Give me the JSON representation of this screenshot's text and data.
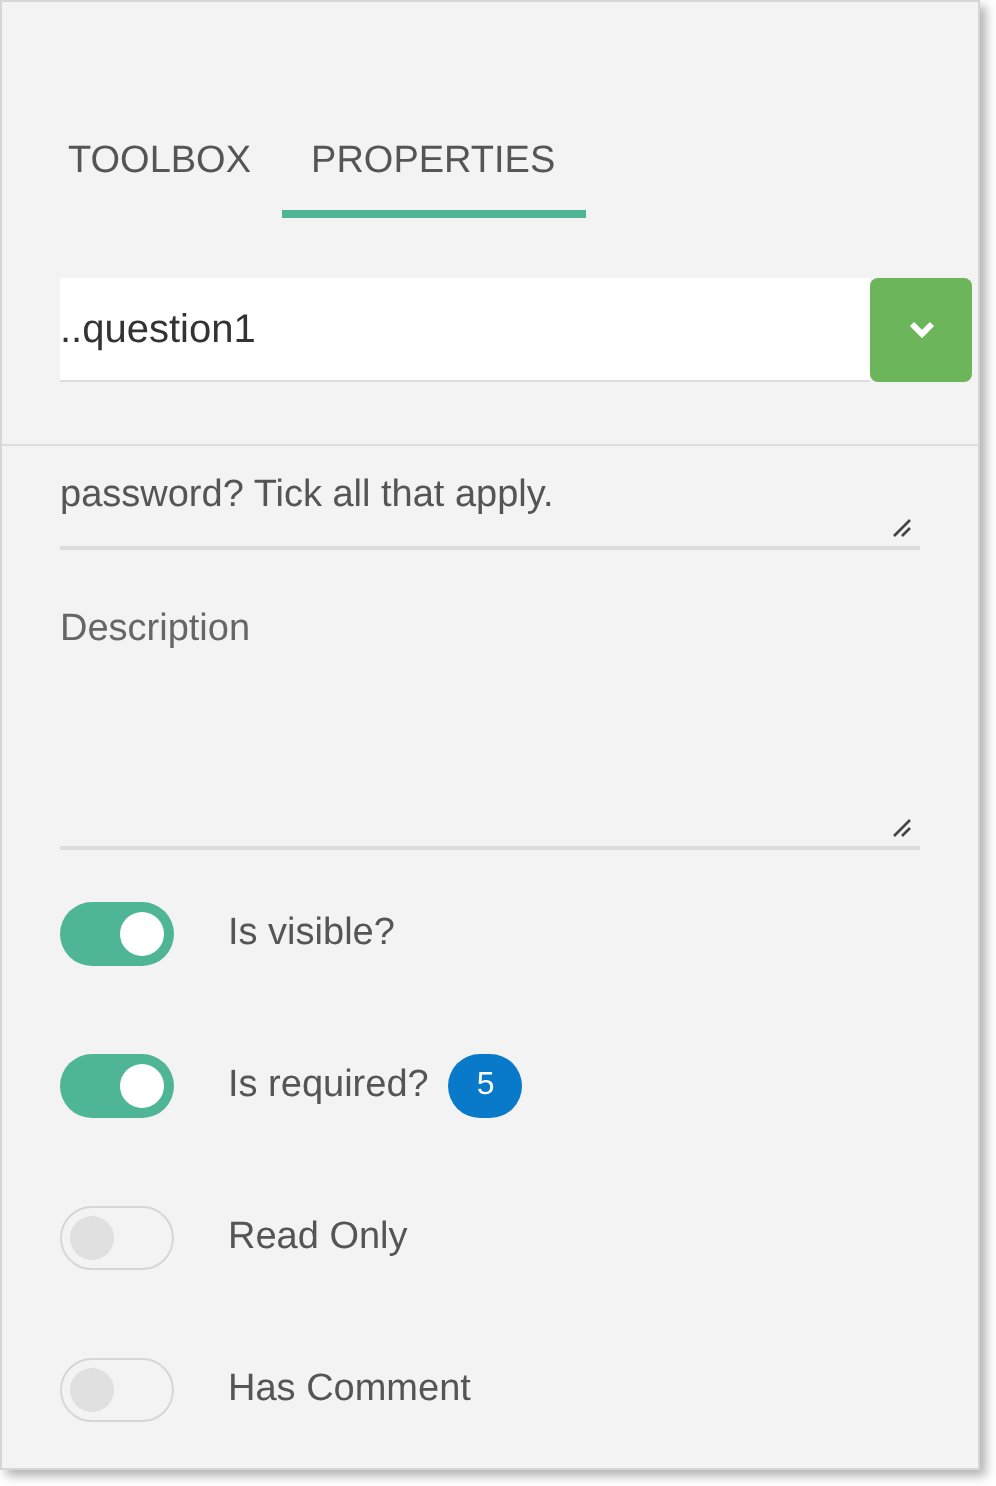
{
  "tabs": [
    {
      "label": "TOOLBOX",
      "selected": false
    },
    {
      "label": "PROPERTIES",
      "selected": true
    }
  ],
  "object_selector": {
    "value": "..question1"
  },
  "title_field": {
    "value": "password? Tick all that apply."
  },
  "description_field": {
    "label": "Description"
  },
  "toggles": [
    {
      "label": "Is visible?",
      "on": true
    },
    {
      "label": "Is required?",
      "on": true,
      "badge": "5"
    },
    {
      "label": "Read Only",
      "on": false
    },
    {
      "label": "Has Comment",
      "on": false
    }
  ]
}
